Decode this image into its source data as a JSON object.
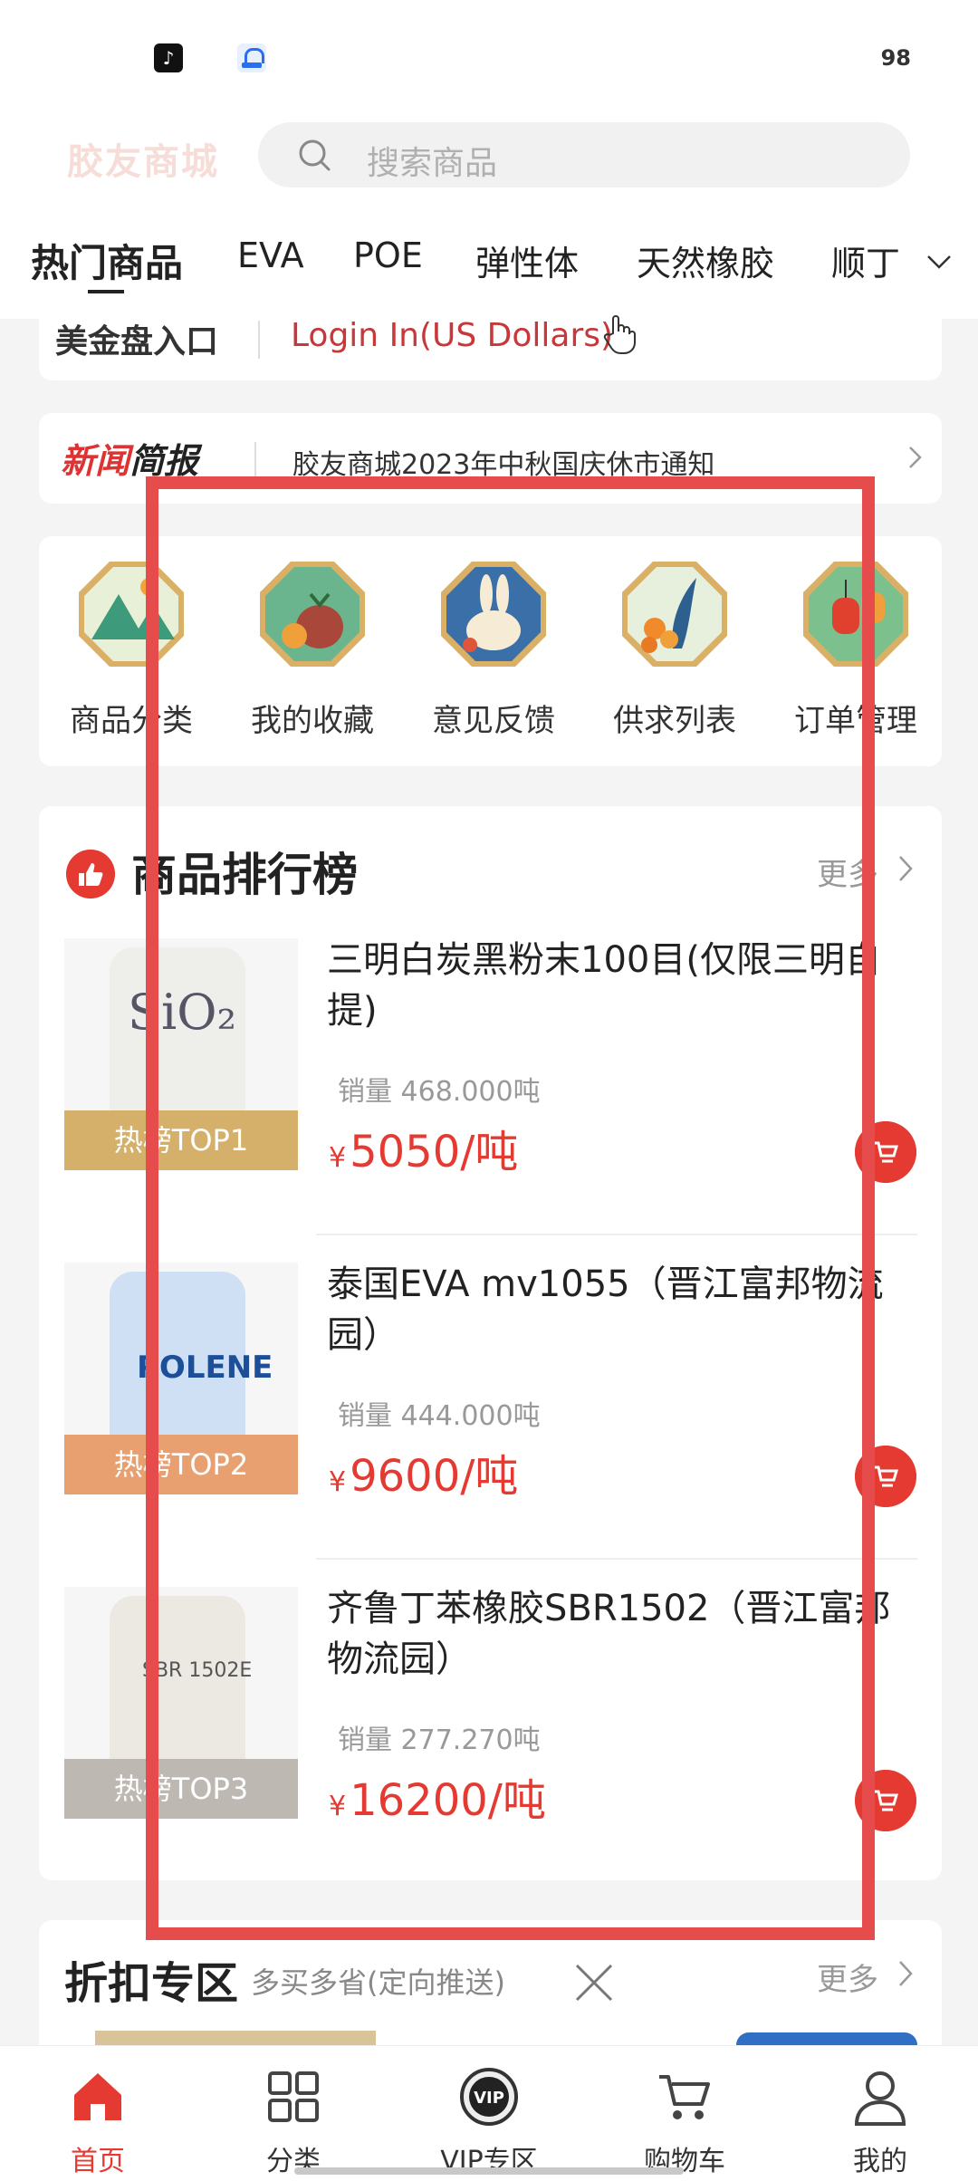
{
  "status_bar": {
    "app_icon_1": "tiktok-icon",
    "app_icon_2": "shield-app-icon",
    "battery": "98"
  },
  "header": {
    "brand": "胶友商城",
    "search_placeholder": "搜索商品"
  },
  "tabs": [
    "热门商品",
    "EVA",
    "POE",
    "弹性体",
    "天然橡胶",
    "顺丁"
  ],
  "login": {
    "left_label": "美金盘入口",
    "right_label": "Login In(US Dollars)"
  },
  "news": {
    "logo_red": "新闻",
    "logo_black": "简报",
    "text": "胶友商城2023年中秋国庆休市通知"
  },
  "menu": [
    {
      "label": "商品分类",
      "icon": "mountain-icon"
    },
    {
      "label": "我的收藏",
      "icon": "persimmon-icon"
    },
    {
      "label": "意见反馈",
      "icon": "rabbit-icon"
    },
    {
      "label": "供求列表",
      "icon": "flower-icon"
    },
    {
      "label": "订单管理",
      "icon": "lantern-icon"
    }
  ],
  "ranking": {
    "title": "商品排行榜",
    "more": "更多",
    "products": [
      {
        "name": "三明白炭黑粉末100目(仅限三明自提)",
        "sales": "销量 468.000吨",
        "yen": "¥",
        "price": "5050/吨",
        "badge": "热榜TOP1",
        "badge_color": "#d4b06a",
        "bag_color": "#eeeeea"
      },
      {
        "name": "泰国EVA mv1055（晋江富邦物流园）",
        "sales": "销量 444.000吨",
        "yen": "¥",
        "price": "9600/吨",
        "badge": "热榜TOP2",
        "badge_color": "#e8a070",
        "bag_color": "#cfe0f4"
      },
      {
        "name": "齐鲁丁苯橡胶SBR1502（晋江富邦物流园）",
        "sales": "销量 277.270吨",
        "yen": "¥",
        "price": "16200/吨",
        "badge": "热榜TOP3",
        "badge_color": "#bdb8b2",
        "bag_color": "#ece8e2"
      }
    ]
  },
  "discount": {
    "title": "折扣专区",
    "subtitle": "多买多省(定向推送)",
    "more": "更多"
  },
  "bottom_nav": [
    {
      "label": "首页",
      "icon": "home-icon"
    },
    {
      "label": "分类",
      "icon": "grid-icon"
    },
    {
      "label": "VIP专区",
      "icon": "vip-icon"
    },
    {
      "label": "购物车",
      "icon": "cart-icon"
    },
    {
      "label": "我的",
      "icon": "user-icon"
    }
  ],
  "colors": {
    "accent": "#e53a32",
    "highlight_box": "#e74c4c"
  }
}
